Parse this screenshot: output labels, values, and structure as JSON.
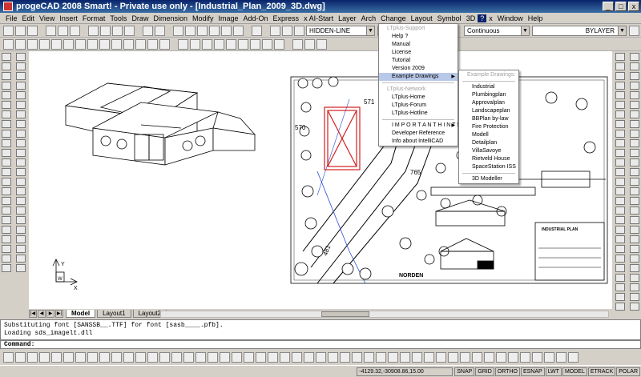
{
  "window": {
    "title": "progeCAD 2008 Smart! - Private use only - [Industrial_Plan_2009_3D.dwg]",
    "min": "_",
    "max": "□",
    "close": "x"
  },
  "menubar": [
    "File",
    "Edit",
    "View",
    "Insert",
    "Format",
    "Tools",
    "Draw",
    "Dimension",
    "Modify",
    "Image",
    "Add-On",
    "Express",
    "x AI-Start",
    "Layer",
    "Arch",
    "Change",
    "Layout",
    "Symbol",
    "3D",
    "?",
    "x",
    "Window",
    "Help"
  ],
  "toolbar": {
    "layer_value": "HIDDEN-LINE",
    "linetype_value": "Continuous",
    "lineweight_value": "BYLAYER"
  },
  "canvas": {
    "label_571": "571",
    "label_570": "570",
    "label_765": "765",
    "label_481": "481",
    "norden": "NORDEN",
    "industrial_plan": "INDUSTRIAL PLAN",
    "ucs_y": "Y",
    "ucs_w": "W",
    "ucs_x": "X"
  },
  "tabs": {
    "model": "Model",
    "layout1": "Layout1",
    "layout2": "Layout2"
  },
  "command": {
    "line1": "Substituting font [SANSSB__.TTF] for font [sasb____.pfb].",
    "line2": "Loading sds_imagelt.dll",
    "prompt": "Command:"
  },
  "status": {
    "coords": "-4129.32,-30908.86,15.00",
    "snap": "SNAP",
    "grid": "GRID",
    "ortho": "ORTHO",
    "esnap": "ESNAP",
    "lwt": "LWT",
    "model": "MODEL",
    "etrack": "ETRACK",
    "polar": "POLAR"
  },
  "help_menu": {
    "header1": "LTplus-Support",
    "items1": [
      "Help ?",
      "Manual",
      "License",
      "Tutorial",
      "Version 2009",
      "Example Drawings"
    ],
    "header2": "LTplus-Network",
    "items2": [
      "LTplus-Home",
      "LTplus-Forum",
      "LTplus-Hotline"
    ],
    "items3": [
      "I M P O R T A N T  H I N T S !",
      "Developer Reference",
      "Info about IntelliCAD"
    ]
  },
  "examples_menu": {
    "header": "Example Drawings:",
    "items": [
      "Industrial",
      "Plumbingplan",
      "Approvalplan",
      "Landscapeplan",
      "BBPlan by-law",
      "Fire Protection",
      "Modell",
      "Detailplan",
      "VillaSavoye",
      "Rietveld House",
      "SpaceStation ISS"
    ],
    "last": "3D Modeller"
  },
  "colors": {
    "title_bar": "#0a246a",
    "menu_highlight": "#b8c8e8",
    "parcel_red": "#d22020",
    "road_blue": "#2a4ad0"
  }
}
